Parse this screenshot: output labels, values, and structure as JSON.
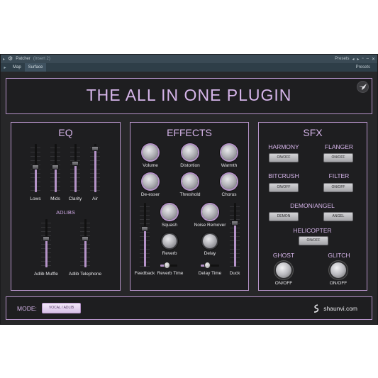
{
  "window": {
    "title": "Patcher",
    "insert": "(Insert 2)",
    "presets_label": "Presets",
    "tabs": [
      "Map",
      "Surface"
    ],
    "tab_presets_label": "Presets"
  },
  "plugin": {
    "title": "THE  ALL IN ONE PLUGIN",
    "eq": {
      "title": "EQ",
      "sliders": [
        {
          "label": "Lows",
          "value": 0.52
        },
        {
          "label": "Mids",
          "value": 0.52
        },
        {
          "label": "Clarity",
          "value": 0.6
        },
        {
          "label": "Air",
          "value": 0.95
        }
      ],
      "adlibs_title": "ADLIBS",
      "adlib_sliders": [
        {
          "label": "Adlib Muffle",
          "value": 0.6
        },
        {
          "label": "Adlib Telephone",
          "value": 0.6
        }
      ]
    },
    "effects": {
      "title": "EFFECTS",
      "knobs": [
        {
          "label": "Volume"
        },
        {
          "label": "Distortion"
        },
        {
          "label": "Warmth"
        },
        {
          "label": "De-esser"
        },
        {
          "label": "Threshold"
        },
        {
          "label": "Chorus"
        },
        {
          "label": "Squash"
        },
        {
          "label": "Noise Remover"
        },
        {
          "label": "Reverb"
        },
        {
          "label": "Delay"
        }
      ],
      "feedback": {
        "label": "Feedback",
        "value": 0.6
      },
      "duck": {
        "label": "Duck",
        "value": 0.7
      },
      "reverb_time": {
        "label": "Reverb Time",
        "value": 0.35
      },
      "delay_time": {
        "label": "Delay Time",
        "value": 0.3
      }
    },
    "sfx": {
      "title": "SFX",
      "harmony": {
        "label": "HARMONY",
        "button": "ON/OFF"
      },
      "flanger": {
        "label": "FLANGER",
        "button": "ON/OFF"
      },
      "bitcrush": {
        "label": "BITCRUSH",
        "button": "ON/OFF"
      },
      "filter": {
        "label": "FILTER",
        "button": "ON/OFF"
      },
      "demon_angel": {
        "label": "DEMON/ANGEL",
        "demon_button": "DEMON",
        "angel_button": "ANGEL"
      },
      "helicopter": {
        "label": "HELICOPTER",
        "button": "ON/OFF"
      },
      "ghost": {
        "label": "GHOST",
        "sublabel": "ON/OFF"
      },
      "glitch": {
        "label": "GLITCH",
        "sublabel": "ON/OFF"
      }
    },
    "mode": {
      "label": "MODE:",
      "value": "VOCAL / ADLIB"
    },
    "brand": "shaunvi.com"
  },
  "colors": {
    "accent": "#b593c8",
    "title": "#d6b5ea",
    "background": "#1e1e20"
  }
}
